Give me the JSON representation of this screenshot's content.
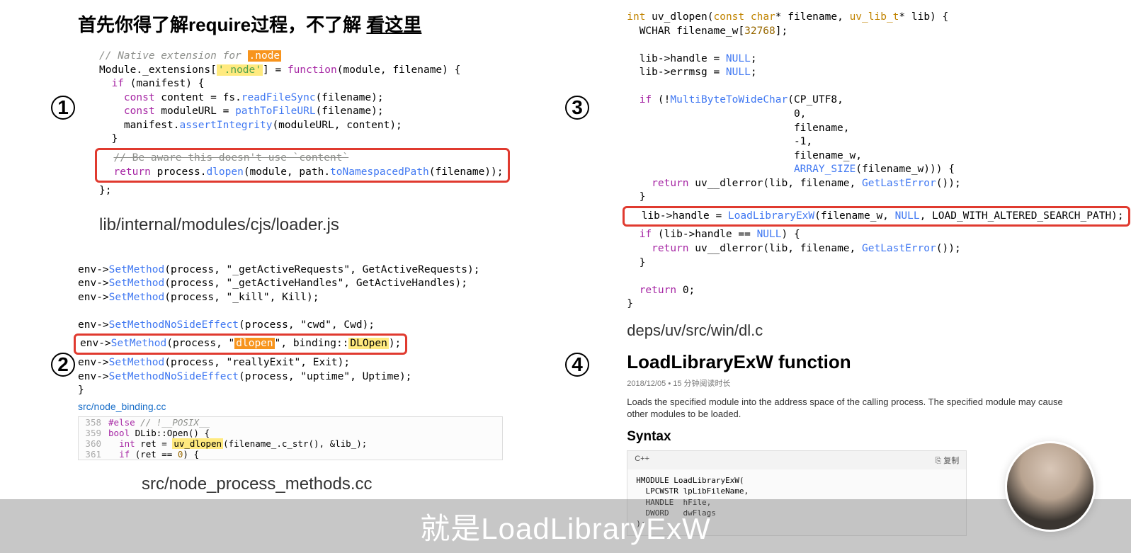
{
  "title": {
    "prefix": "首先你得了解require过程，不了解",
    "link": "看这里"
  },
  "markers": [
    "1",
    "2",
    "3",
    "4"
  ],
  "block1": {
    "comment": "// Native extension for ",
    "node_hl": ".node",
    "line2_pre": "Module._extensions[",
    "line2_str": "'.node'",
    "line2_post": "] = ",
    "line2_fn": "function",
    "line2_args": "(module, filename) {",
    "line3_if": "if",
    "line3_rest": " (manifest) {",
    "line4_const": "const",
    "line4_rest1": " content = fs.",
    "line4_fn": "readFileSync",
    "line4_rest2": "(filename);",
    "line5_const": "const",
    "line5_rest1": " moduleURL = ",
    "line5_fn": "pathToFileURL",
    "line5_rest2": "(filename);",
    "line6_pre": "manifest.",
    "line6_fn": "assertIntegrity",
    "line6_rest": "(moduleURL, content);",
    "line7": "}",
    "line8_strike": "// Be aware this doesn't use `content`",
    "line9_ret": "return",
    "line9_rest1": " process.",
    "line9_fn1": "dlopen",
    "line9_rest2": "(module, path.",
    "line9_fn2": "toNamespacedPath",
    "line9_rest3": "(filename));",
    "line10": "};"
  },
  "path1": "lib/internal/modules/cjs/loader.js",
  "block2": {
    "l1_pre": "env->",
    "l1_fn": "SetMethod",
    "l1_rest": "(process, \"_getActiveRequests\", GetActiveRequests);",
    "l2_pre": "env->",
    "l2_fn": "SetMethod",
    "l2_rest": "(process, \"_getActiveHandles\", GetActiveHandles);",
    "l3_pre": "env->",
    "l3_fn": "SetMethod",
    "l3_rest": "(process, \"_kill\", Kill);",
    "l4_pre": "env->",
    "l4_fn": "SetMethodNoSideEffect",
    "l4_rest": "(process, \"cwd\", Cwd);",
    "l5_pre": "env->",
    "l5_fn": "SetMethod",
    "l5_rest1": "(process, \"",
    "l5_hl1": "dlopen",
    "l5_rest2": "\", binding::",
    "l5_hl2": "DLOpen",
    "l5_rest3": ");",
    "l6_pre": "env->",
    "l6_fn": "SetMethod",
    "l6_rest": "(process, \"reallyExit\", Exit);",
    "l7_pre": "env->",
    "l7_fn": "SetMethodNoSideEffect",
    "l7_rest": "(process, \"uptime\", Uptime);",
    "l8": "}"
  },
  "src_link": "src/node_binding.cc",
  "mini": {
    "ln358": "358",
    "l358a": "#else",
    "l358b": "   // !__POSIX__",
    "ln359": "359",
    "l359a": "bool",
    "l359b": " DLib::Open() {",
    "ln360": "360",
    "l360a": "int",
    "l360b": " ret = ",
    "l360c": "uv_dlopen",
    "l360d": "(filename_.c_str(), &lib_);",
    "ln361": "361",
    "l361a": "if",
    "l361b": " (ret == ",
    "l361c": "0",
    "l361d": ") {"
  },
  "path2": "src/node_process_methods.cc",
  "block3": {
    "sig_pre": "int",
    "sig_fn": " uv_dlopen",
    "sig_args1": "(",
    "sig_const": "const",
    "sig_char": " char",
    "sig_args2": "* filename, ",
    "sig_type": "uv_lib_t",
    "sig_args3": "* lib) {",
    "l2_pre": "WCHAR filename_w[",
    "l2_num": "32768",
    "l2_post": "];",
    "l4": "lib->handle = ",
    "l4_null": "NULL",
    "l4_end": ";",
    "l5": "lib->errmsg = ",
    "l5_null": "NULL",
    "l5_end": ";",
    "l7_if": "if",
    "l7_rest": " (!",
    "l7_fn": "MultiByteToWideChar",
    "l7_args": "(CP_UTF8,",
    "l8": "0,",
    "l9": "filename,",
    "l10": "-1,",
    "l11": "filename_w,",
    "l12_fn": "ARRAY_SIZE",
    "l12_rest": "(filename_w))) {",
    "l13_ret": "return",
    "l13_fn": " uv__dlerror",
    "l13_rest": "(lib, filename, ",
    "l13_gle": "GetLastError",
    "l13_end": "());",
    "l14": "}",
    "box_pre": "lib->handle = ",
    "box_fn": "LoadLibraryExW",
    "box_rest1": "(filename_w, ",
    "box_null": "NULL",
    "box_rest2": ", LOAD_WITH_ALTERED_SEARCH_PATH);",
    "l16_if": "if",
    "l16_rest": " (lib->handle == ",
    "l16_null": "NULL",
    "l16_end": ") {",
    "l17_ret": "return",
    "l17_fn": " uv__dlerror",
    "l17_rest": "(lib, filename, ",
    "l17_gle": "GetLastError",
    "l17_end": "());",
    "l18": "}",
    "l20_ret": "return",
    "l20_rest": " 0;",
    "l21": "}"
  },
  "path3": "deps/uv/src/win/dl.c",
  "doc": {
    "title": "LoadLibraryExW function",
    "meta": "2018/12/05 • 15 分钟阅读时长",
    "body": "Loads the specified module into the address space of the calling process. The specified module may cause other modules to be loaded.",
    "syntax_h": "Syntax",
    "lang": "C++",
    "copy": "复制",
    "code": "HMODULE LoadLibraryExW(\n  LPCWSTR lpLibFileName,\n  HANDLE  hFile,\n  DWORD   dwFlags\n);"
  },
  "subtitle": "就是LoadLibraryExW"
}
